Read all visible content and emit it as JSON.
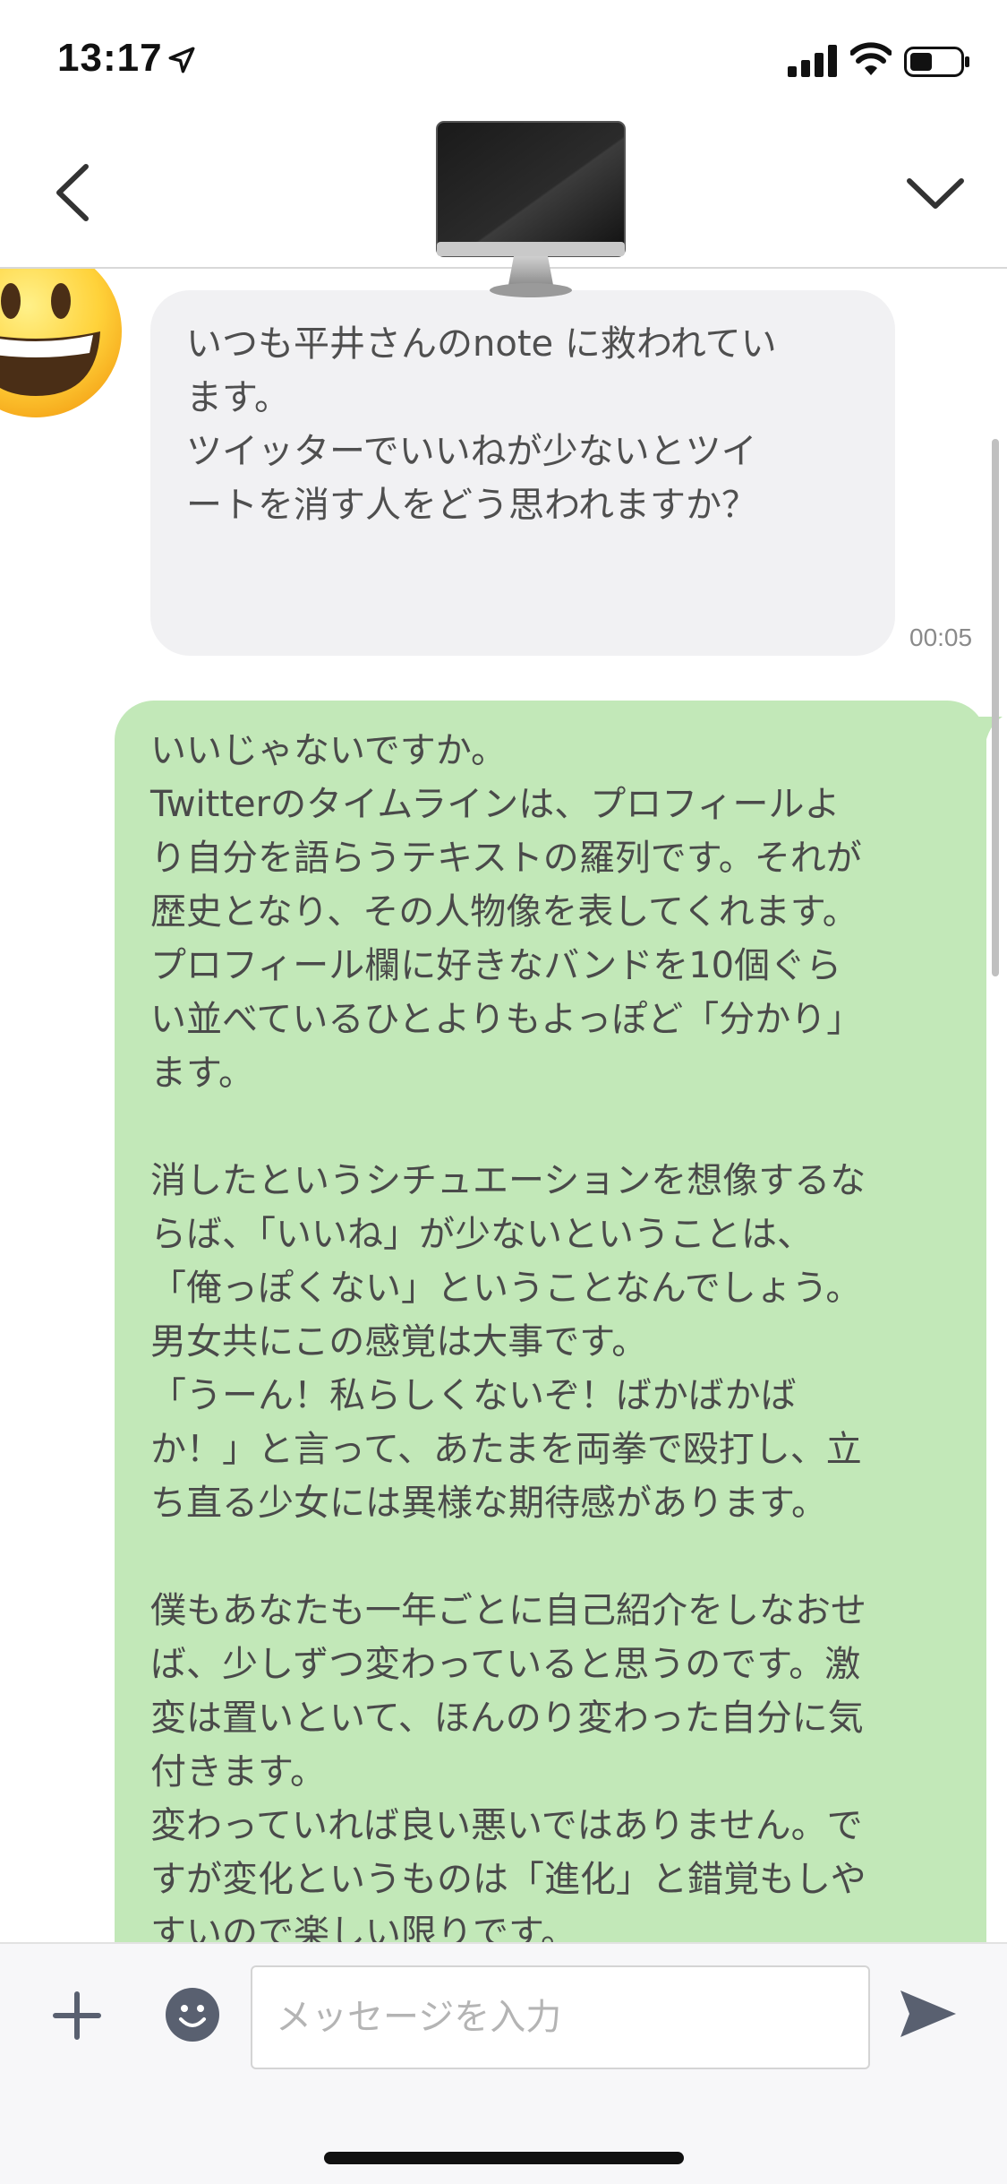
{
  "status_bar": {
    "time": "13:17",
    "icons": [
      "location-arrow-icon",
      "cellular-signal-icon",
      "wifi-icon",
      "battery-icon"
    ]
  },
  "header": {
    "back_icon": "chevron-left-icon",
    "avatar_icon": "desktop-computer-icon",
    "menu_icon": "chevron-down-icon"
  },
  "messages": [
    {
      "direction": "incoming",
      "sender_icon": "grinning-face-emoji",
      "text": "いつも平井さんのnote に救われてい\nます。\nツイッターでいいねが少ないとツイ\nートを消す人をどう思われますか？",
      "time": "00:05"
    },
    {
      "direction": "outgoing",
      "text": "いいじゃないですか。\nTwitterのタイムラインは、プロフィールよ\nり自分を語らうテキストの羅列です。それが\n歴史となり、その人物像を表してくれます。\nプロフィール欄に好きなバンドを10個ぐら\nい並べているひとよりもよっぽど「分かり」\nます。\n\n消したというシチュエーションを想像するな\nらば、「いいね」が少ないということは、\n「俺っぽくない」ということなんでしょう。\n男女共にこの感覚は大事です。\n「うーん！私らしくないぞ！ばかばかば\nか！」と言って、あたまを両拳で殴打し、立\nち直る少女には異様な期待感があります。\n\n僕もあなたも一年ごとに自己紹介をしなおせ\nば、少しずつ変わっていると思うのです。激\n変は置いといて、ほんのり変わった自分に気\n付きます。\n変わっていれば良い悪いではありません。で\nすが変化というものは「進化」と錯覚もしや\nすいので楽しい限りです。"
    }
  ],
  "input_bar": {
    "placeholder": "メッセージを入力",
    "plus_icon": "plus-icon",
    "emoji_icon": "smiley-face-icon",
    "send_icon": "send-arrow-icon"
  },
  "colors": {
    "incoming_bubble": "#f1f1f3",
    "outgoing_bubble": "#c2e8b8",
    "icon_gray": "#596070"
  }
}
